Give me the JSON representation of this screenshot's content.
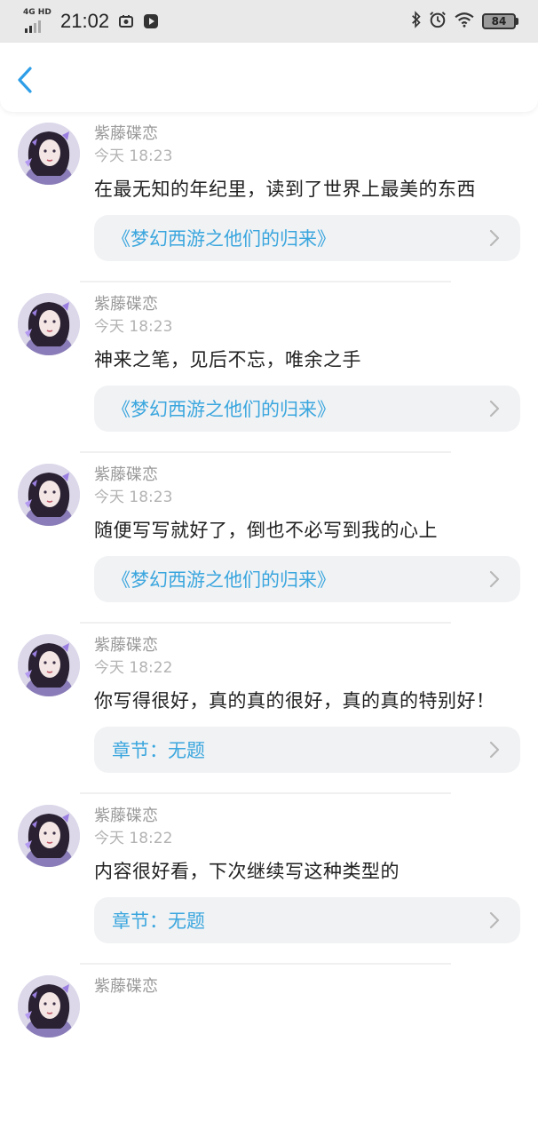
{
  "status_bar": {
    "network": "4G HD",
    "time": "21:02",
    "battery": "84"
  },
  "comments": [
    {
      "user": "紫藤碟恋",
      "time": "今天 18:23",
      "text": "在最无知的年纪里，读到了世界上最美的东西",
      "link": "《梦幻西游之他们的归来》"
    },
    {
      "user": "紫藤碟恋",
      "time": "今天 18:23",
      "text": "神来之笔，见后不忘，唯余之手",
      "link": "《梦幻西游之他们的归来》"
    },
    {
      "user": "紫藤碟恋",
      "time": "今天 18:23",
      "text": "随便写写就好了，倒也不必写到我的心上",
      "link": "《梦幻西游之他们的归来》"
    },
    {
      "user": "紫藤碟恋",
      "time": "今天 18:22",
      "text": "你写得很好，真的真的很好，真的真的特别好！",
      "link": "章节：无题"
    },
    {
      "user": "紫藤碟恋",
      "time": "今天 18:22",
      "text": "内容很好看，下次继续写这种类型的",
      "link": "章节：无题"
    },
    {
      "user": "紫藤碟恋",
      "time": "",
      "text": "",
      "link": ""
    }
  ],
  "colors": {
    "accent": "#3aa6de",
    "status_bar_bg": "#e9e9e9",
    "link_bg": "#f1f2f4"
  }
}
